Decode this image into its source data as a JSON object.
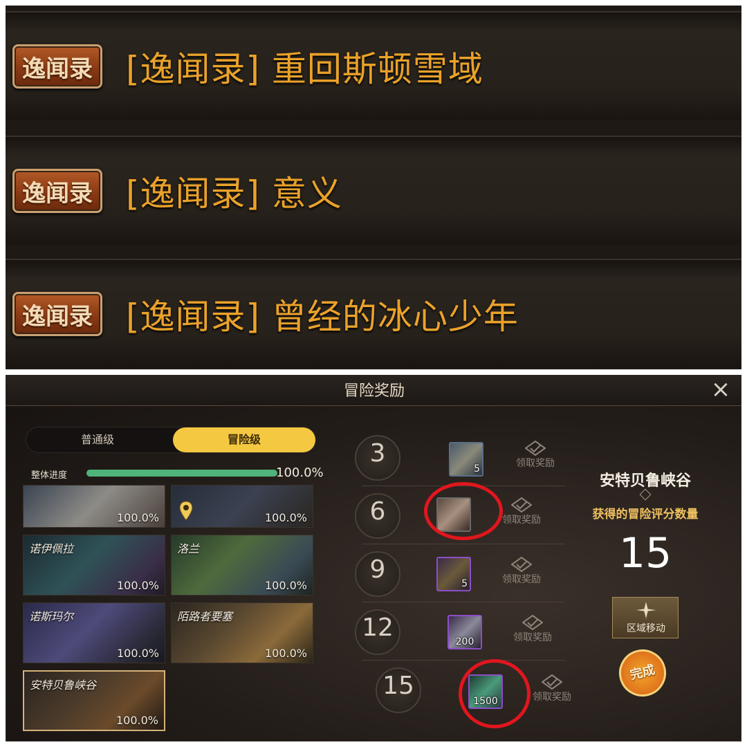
{
  "quests": [
    {
      "badge": "逸闻录",
      "title": "[逸闻录] 重回斯顿雪域"
    },
    {
      "badge": "逸闻录",
      "title": "[逸闻录] 意义"
    },
    {
      "badge": "逸闻录",
      "title": "[逸闻录] 曾经的冰心少年"
    }
  ],
  "rewards_panel": {
    "title": "冒险奖励",
    "close_icon": "×",
    "tabs": [
      {
        "label": "普通级",
        "active": false
      },
      {
        "label": "冒险级",
        "active": true
      }
    ],
    "overall": {
      "label": "整体进度",
      "percent_text": "100.0%",
      "fill": 1.0
    },
    "regions": [
      {
        "name": "",
        "percent": "100.0%",
        "pin": false
      },
      {
        "name": "",
        "percent": "100.0%",
        "pin": true
      },
      {
        "name": "诺伊佩拉",
        "percent": "100.0%"
      },
      {
        "name": "洛兰",
        "percent": "100.0%"
      },
      {
        "name": "诺斯玛尔",
        "percent": "100.0%"
      },
      {
        "name": "陌路者要塞",
        "percent": "100.0%"
      },
      {
        "name": "安特贝鲁峡谷",
        "percent": "100.0%",
        "selected": true
      }
    ],
    "reward_rows": [
      {
        "tier": "3",
        "item_count": "5",
        "item_icon": "crate-icon",
        "claim_label": "领取奖励"
      },
      {
        "tier": "6",
        "item_count": "",
        "item_icon": "chest-icon",
        "claim_label": "领取奖励",
        "circled": true
      },
      {
        "tier": "9",
        "item_count": "5",
        "item_icon": "purple-bag-icon",
        "claim_label": "领取奖励"
      },
      {
        "tier": "12",
        "item_count": "200",
        "item_icon": "purple-box-icon",
        "claim_label": "领取奖励"
      },
      {
        "tier": "15",
        "item_count": "1500",
        "item_icon": "green-crystal-icon",
        "claim_label": "领取奖励",
        "circled": true
      }
    ],
    "region_info": {
      "name": "安特贝鲁峡谷",
      "score_label": "获得的冒险评分数量",
      "score_value": "15",
      "move_button": "区域移动",
      "complete_stamp": "完成"
    },
    "colors": {
      "tab_active": "#f5c842",
      "progress_fill": "#4fb37a",
      "score_label": "#f0c060",
      "quest_title": "#eaa22a",
      "highlight_circle": "#e0161e"
    }
  }
}
